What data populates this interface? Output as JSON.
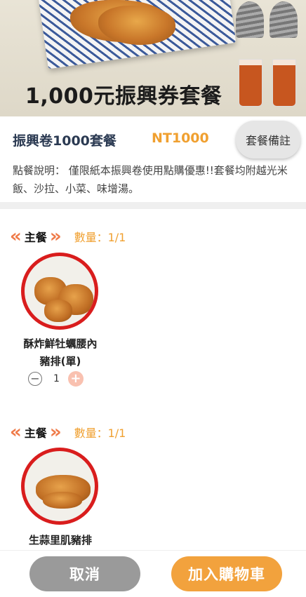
{
  "banner": {
    "title": "1,000元振興券套餐"
  },
  "set": {
    "title": "振興卷1000套餐",
    "price": "NT1000",
    "note_button": "套餐備註",
    "description": "點餐說明： 僅限紙本振興卷使用點購優惠!!套餐均附越光米飯、沙拉、小菜、味增湯。"
  },
  "sections": [
    {
      "label": "主餐",
      "quantity": "數量：1/1",
      "item": {
        "name_line1": "酥炸鮮牡蠣腰內",
        "name_line2": "豬排(單)",
        "count": "1"
      }
    },
    {
      "label": "主餐",
      "quantity": "數量：1/1",
      "item": {
        "name_line1": "生蒜里肌豬排"
      }
    }
  ],
  "footer": {
    "cancel": "取消",
    "add_to_cart": "加入購物車"
  },
  "icons": {
    "left_chevron": "double-chevron-left-icon",
    "right_chevron": "double-chevron-right-icon",
    "minus": "minus-icon",
    "plus": "plus-icon"
  },
  "colors": {
    "accent_orange": "#f0a030",
    "chevron": "#ef7a48",
    "image_ring": "#d91d1d",
    "cancel_gray": "#9a9a9a",
    "add_orange": "#f2a23d"
  }
}
